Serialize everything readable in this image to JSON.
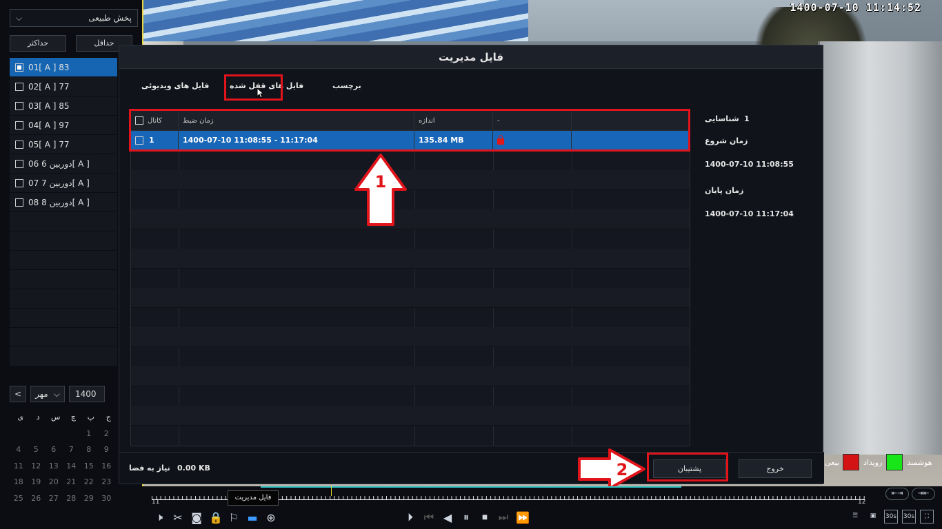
{
  "camera": {
    "timestamp": "1400-07-10  11:14:52"
  },
  "sidebar": {
    "mode": "پخش طبیعی",
    "max_btn": "حداکثر",
    "min_btn": "حداقل",
    "channels": [
      {
        "label": "01[ A ] 83",
        "selected": true
      },
      {
        "label": "02[ A ] 77",
        "selected": false
      },
      {
        "label": "03[ A ] 85",
        "selected": false
      },
      {
        "label": "04[ A ] 97",
        "selected": false
      },
      {
        "label": "05[ A ] 77",
        "selected": false
      },
      {
        "label": "دوربین 6 06[ A ]",
        "selected": false
      },
      {
        "label": "دوربین 7 07[ A ]",
        "selected": false
      },
      {
        "label": "دوربین 8 08[ A ]",
        "selected": false
      }
    ],
    "year": "1400",
    "month": "مهر",
    "prev": "<",
    "weekdays": [
      "ج",
      "پ",
      "چ",
      "س",
      "د",
      "ی"
    ],
    "cal_rows": [
      [
        "",
        "",
        "",
        "",
        "1",
        "2"
      ],
      [
        "4",
        "5",
        "6",
        "7",
        "8",
        "9"
      ],
      [
        "11",
        "12",
        "13",
        "14",
        "15",
        "16"
      ],
      [
        "18",
        "19",
        "20",
        "21",
        "22",
        "23"
      ],
      [
        "25",
        "26",
        "27",
        "28",
        "29",
        "30"
      ]
    ]
  },
  "dialog": {
    "title": "فایل مدیریت",
    "tabs": {
      "video": "فایل های ویدیوئی",
      "locked": "فایل های قفل شده",
      "tag": "برچسب"
    },
    "columns": {
      "channel": "کانال",
      "time": "زمان ضبط",
      "size": "اندازه",
      "extra": "-"
    },
    "row": {
      "channel": "1",
      "time": "1400-07-10 11:08:55 - 11:17:04",
      "size": "135.84 MB"
    },
    "info": {
      "id_label": "شناسایی",
      "id_value": "1",
      "start_label": "زمان شروع",
      "start_value": "1400-07-10 11:08:55",
      "end_label": "زمان پایان",
      "end_value": "1400-07-10 11:17:04"
    },
    "footer": {
      "space_label": "نیاز به فضا",
      "space_value": "0.00 KB",
      "backup": "پشتیبان",
      "exit": "خروج"
    }
  },
  "annotations": {
    "arrow1": "1",
    "arrow2": "2"
  },
  "legend": {
    "smart": "هوشمند",
    "event": "رویداد",
    "normal": "طبیعی",
    "smart_color": "#19e619",
    "event_color": "#d41414"
  },
  "timeline": {
    "start": "11",
    "end": "12",
    "tooltip": "فایل مدیریت"
  }
}
